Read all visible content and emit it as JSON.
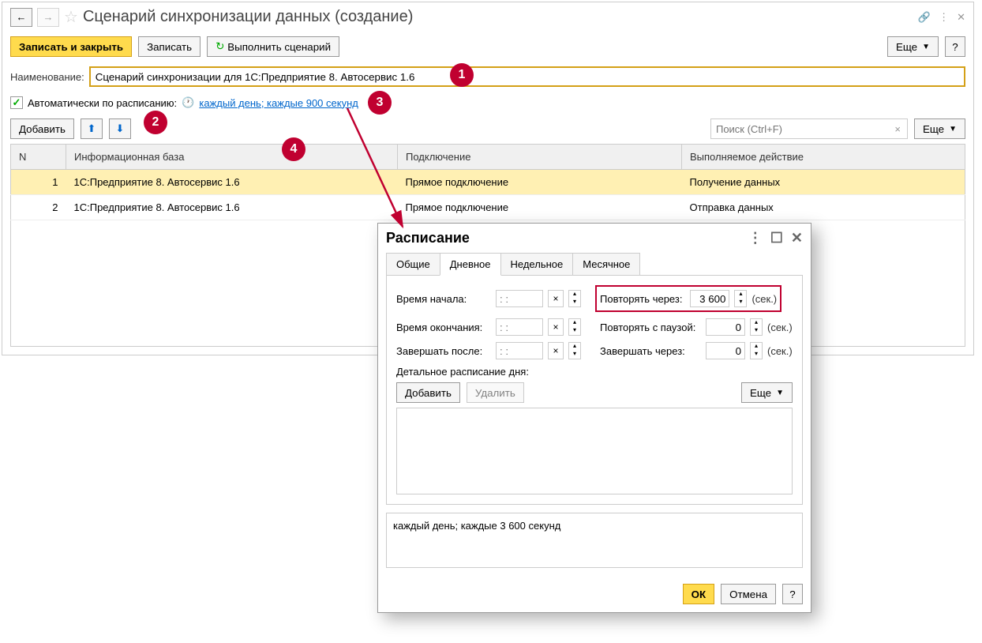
{
  "title": "Сценарий синхронизации данных (создание)",
  "toolbar": {
    "save_close": "Записать и закрыть",
    "save": "Записать",
    "run": "Выполнить сценарий",
    "more": "Еще"
  },
  "form": {
    "name_label": "Наименование:",
    "name_value": "Сценарий синхронизации для 1С:Предприятие 8. Автосервис 1.6",
    "auto_label": "Автоматически по расписанию:",
    "schedule_text": "каждый день; каждые 900 секунд",
    "add": "Добавить"
  },
  "search": {
    "placeholder": "Поиск (Ctrl+F)"
  },
  "table": {
    "headers": {
      "n": "N",
      "base": "Информационная база",
      "conn": "Подключение",
      "action": "Выполняемое действие"
    },
    "rows": [
      {
        "n": "1",
        "base": "1С:Предприятие 8. Автосервис 1.6",
        "conn": "Прямое подключение",
        "action": "Получение данных"
      },
      {
        "n": "2",
        "base": "1С:Предприятие 8. Автосервис 1.6",
        "conn": "Прямое подключение",
        "action": "Отправка данных"
      }
    ]
  },
  "dialog": {
    "title": "Расписание",
    "tabs": {
      "general": "Общие",
      "daily": "Дневное",
      "weekly": "Недельное",
      "monthly": "Месячное"
    },
    "fields": {
      "start_time": "Время начала:",
      "end_time": "Время окончания:",
      "finish_after": "Завершать после:",
      "repeat_every": "Повторять через:",
      "repeat_pause": "Повторять с паузой:",
      "finish_in": "Завершать через:",
      "time_placeholder": ": :",
      "repeat_value": "3 600",
      "pause_value": "0",
      "finish_value": "0",
      "sec": "(сек.)"
    },
    "detail_label": "Детальное расписание дня:",
    "add": "Добавить",
    "delete": "Удалить",
    "more": "Еще",
    "description": "каждый день; каждые 3 600 секунд",
    "ok": "ОК",
    "cancel": "Отмена"
  },
  "badges": {
    "b1": "1",
    "b2": "2",
    "b3": "3",
    "b4": "4"
  }
}
